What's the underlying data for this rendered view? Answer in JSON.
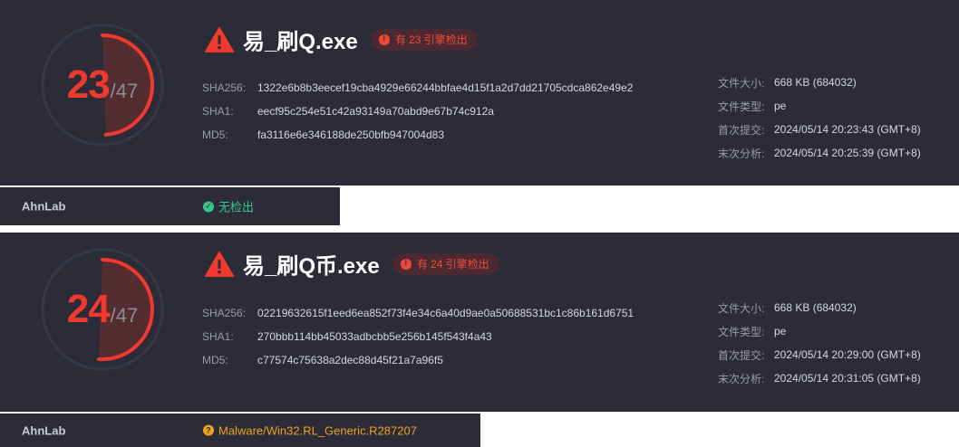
{
  "colors": {
    "card_bg": "#2b2c38",
    "danger": "#f03a2e",
    "ok": "#39c48c",
    "warning": "#f0a020"
  },
  "reports": [
    {
      "detections": "23",
      "total": "/47",
      "detection_ratio": 0.489,
      "file_name": "易_刷Q.exe",
      "badge": "有 23 引擎检出",
      "hashes": {
        "sha256_label": "SHA256:",
        "sha256": "1322e6b8b3eecef19cba4929e66244bbfae4d15f1a2d7dd21705cdca862e49e2",
        "sha1_label": "SHA1:",
        "sha1": "eecf95c254e51c42a93149a70abd9e67b74c912a",
        "md5_label": "MD5:",
        "md5": "fa3116e6e346188de250bfb947004d83"
      },
      "meta": {
        "size_label": "文件大小:",
        "size": "668 KB (684032)",
        "type_label": "文件类型:",
        "type": "pe",
        "first_label": "首次提交:",
        "first": "2024/05/14 20:23:43 (GMT+8)",
        "last_label": "末次分析:",
        "last": "2024/05/14 20:25:39 (GMT+8)"
      },
      "engine": {
        "name": "AhnLab",
        "result": "无检出",
        "status": "ok",
        "icon": "check-circle-icon"
      }
    },
    {
      "detections": "24",
      "total": "/47",
      "detection_ratio": 0.511,
      "file_name": "易_刷Q币.exe",
      "badge": "有 24 引擎检出",
      "hashes": {
        "sha256_label": "SHA256:",
        "sha256": "02219632615f1eed6ea852f73f4e34c6a40d9ae0a50688531bc1c86b161d6751",
        "sha1_label": "SHA1:",
        "sha1": "270bbb114bb45033adbcbb5e256b145f543f4a43",
        "md5_label": "MD5:",
        "md5": "c77574c75638a2dec88d45f21a7a96f5"
      },
      "meta": {
        "size_label": "文件大小:",
        "size": "668 KB (684032)",
        "type_label": "文件类型:",
        "type": "pe",
        "first_label": "首次提交:",
        "first": "2024/05/14 20:29:00 (GMT+8)",
        "last_label": "末次分析:",
        "last": "2024/05/14 20:31:05 (GMT+8)"
      },
      "engine": {
        "name": "AhnLab",
        "result": "Malware/Win32.RL_Generic.R287207",
        "status": "warning",
        "icon": "question-circle-icon"
      }
    }
  ]
}
